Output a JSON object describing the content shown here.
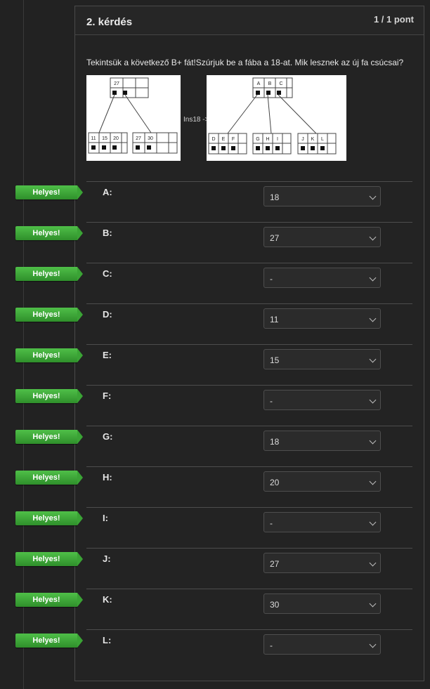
{
  "question": {
    "title": "2. kérdés",
    "points": "1 / 1 pont",
    "text": "Tekintsük a következő B+ fát!Szúrjuk be a fába a 18-at. Mik lesznek az új fa csúcsai?",
    "ins_label": "Ins18 ->"
  },
  "tree_before": {
    "root_keys": [
      "27",
      "",
      ""
    ],
    "leaves": [
      [
        "11",
        "15",
        "20"
      ],
      [
        "27",
        "30",
        ""
      ]
    ]
  },
  "tree_after": {
    "root_keys": [
      "A",
      "B",
      "C"
    ],
    "leaves": [
      [
        "D",
        "E",
        "F"
      ],
      [
        "G",
        "H",
        "I"
      ],
      [
        "J",
        "K",
        "L"
      ]
    ]
  },
  "badge_label": "Helyes!",
  "answers": [
    {
      "label": "A:",
      "value": "18"
    },
    {
      "label": "B:",
      "value": "27"
    },
    {
      "label": "C:",
      "value": "-"
    },
    {
      "label": "D:",
      "value": "11"
    },
    {
      "label": "E:",
      "value": "15"
    },
    {
      "label": "F:",
      "value": "-"
    },
    {
      "label": "G:",
      "value": "18"
    },
    {
      "label": "H:",
      "value": "20"
    },
    {
      "label": "I:",
      "value": "-"
    },
    {
      "label": "J:",
      "value": "27"
    },
    {
      "label": "K:",
      "value": "30"
    },
    {
      "label": "L:",
      "value": "-"
    }
  ]
}
